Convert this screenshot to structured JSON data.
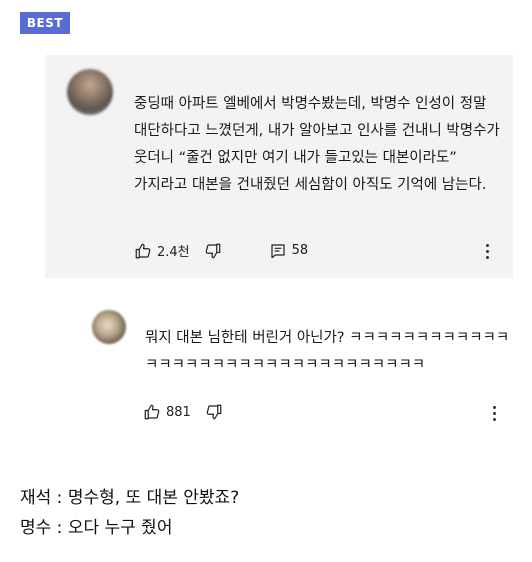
{
  "badge": {
    "label": "BEST"
  },
  "main_comment": {
    "text": "중딩때 아파트 엘베에서 박명수봤는데, 박명수 인성이 정말 대단하다고 느꼈던게, 내가 알아보고 인사를 건내니 박명수가 웃더니 “줄건 없지만 여기 내가 들고있는 대본이라도” 가지라고 대본을 건내줬던 세심함이 아직도 기억에 남는다.",
    "likes": "2.4천",
    "replies": "58"
  },
  "reply_comment": {
    "text": "뭐지 대본 님한테 버린거 아닌가? ㅋㅋㅋㅋㅋㅋㅋㅋㅋㅋㅋㅋㅋㅋㅋㅋㅋㅋㅋㅋㅋㅋㅋㅋㅋㅋㅋㅋㅋㅋㅋㅋㅋ",
    "likes": "881"
  },
  "dialogue": {
    "line1": "재석 : 명수형, 또 대본 안봤죠?",
    "line2": "명수 : 오다 누구 줬어"
  },
  "icons": {
    "like": "thumbs-up-icon",
    "dislike": "thumbs-down-icon",
    "reply": "comment-icon",
    "more": "more-vertical-icon"
  }
}
